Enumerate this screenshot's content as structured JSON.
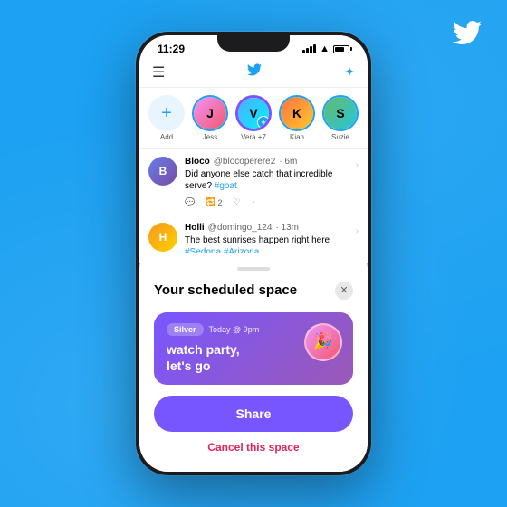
{
  "background": {
    "color": "#1da1f2"
  },
  "twitter_logo": "🐦",
  "phone": {
    "status_bar": {
      "time": "11:29"
    },
    "header": {
      "menu_icon": "☰",
      "sparkle_icon": "✦"
    },
    "stories": [
      {
        "name": "Add",
        "type": "add"
      },
      {
        "name": "Jess",
        "type": "normal",
        "av": "av1"
      },
      {
        "name": "Vera +7",
        "type": "active",
        "av": "av2"
      },
      {
        "name": "Kian",
        "type": "normal",
        "av": "av4"
      },
      {
        "name": "Suzie",
        "type": "normal",
        "av": "av5"
      }
    ],
    "tweets": [
      {
        "user": "Bloco",
        "handle": "@blocoperere2",
        "time": "6m",
        "text": "Did anyone else catch that incredible serve?",
        "hashtag": "#goat",
        "av": "av-bloco",
        "reply_count": "",
        "retweet_count": "2",
        "like_count": ""
      },
      {
        "user": "Holli",
        "handle": "@domingo_124",
        "time": "13m",
        "text": "The best sunrises happen right here",
        "hashtag": "#Sedona #Arizona",
        "av": "av-holli"
      }
    ],
    "bottom_sheet": {
      "title": "Your scheduled space",
      "close_icon": "✕",
      "space_card": {
        "host_label": "Silver",
        "time": "Today @ 9pm",
        "title": "watch party,\nlet's go"
      },
      "share_button": "Share",
      "cancel_text": "Cancel this space"
    }
  }
}
